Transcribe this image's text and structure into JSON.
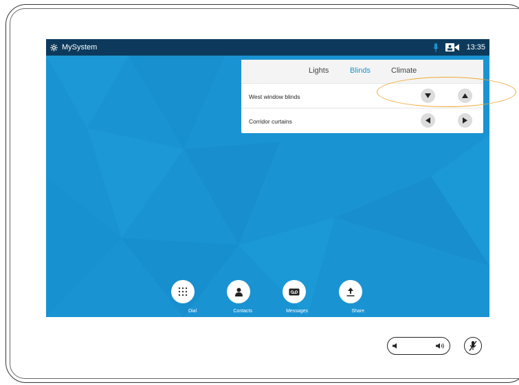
{
  "status": {
    "system_name": "MySystem",
    "time": "13:35",
    "icons": [
      "settings-gear-icon",
      "microphone-icon",
      "video-camera-icon"
    ]
  },
  "control_panel": {
    "tabs": [
      {
        "label": "Lights",
        "active": false
      },
      {
        "label": "Blinds",
        "active": true
      },
      {
        "label": "Climate",
        "active": false
      }
    ],
    "rows": [
      {
        "label": "West window blinds",
        "controls": [
          "arrow-down-icon",
          "arrow-up-icon"
        ]
      },
      {
        "label": "Corridor curtains",
        "controls": [
          "arrow-left-icon",
          "arrow-right-icon"
        ]
      }
    ]
  },
  "dock": {
    "items": [
      {
        "label": "Dial",
        "icon": "keypad-icon"
      },
      {
        "label": "Contacts",
        "icon": "person-icon"
      },
      {
        "label": "Messages",
        "icon": "voicemail-icon"
      },
      {
        "label": "Share",
        "icon": "upload-icon"
      }
    ]
  },
  "hardware": {
    "volume_icons": [
      "volume-down-icon",
      "volume-up-icon"
    ],
    "mute_icon": "microphone-mute-icon"
  },
  "colors": {
    "accent": "#1793d1",
    "screen_bg": "#1a93d3",
    "statusbar": "#0d3a5c",
    "highlight": "#f0a830"
  }
}
